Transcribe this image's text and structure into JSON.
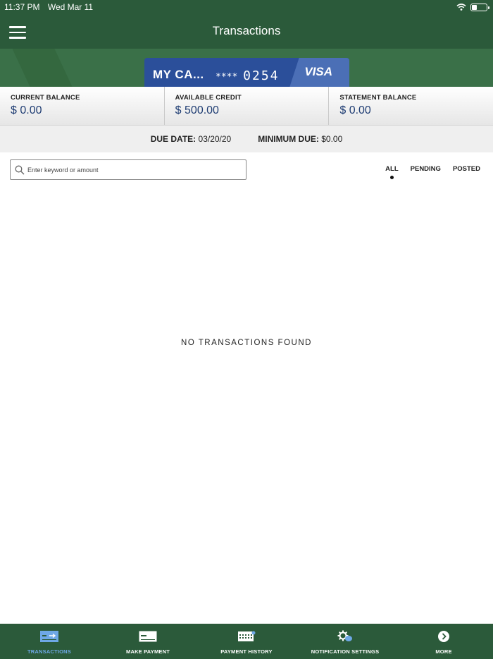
{
  "status_bar": {
    "time": "11:37 PM",
    "date": "Wed Mar 11"
  },
  "header": {
    "title": "Transactions"
  },
  "card": {
    "name": "MY CA...",
    "masked_prefix": "****",
    "last4": "0254",
    "network": "VISA"
  },
  "balances": [
    {
      "label": "CURRENT BALANCE",
      "value": "$ 0.00"
    },
    {
      "label": "AVAILABLE CREDIT",
      "value": "$ 500.00"
    },
    {
      "label": "STATEMENT BALANCE",
      "value": "$ 0.00"
    }
  ],
  "due": {
    "due_label": "DUE DATE:",
    "due_value": "03/20/20",
    "min_label": "MINIMUM DUE:",
    "min_value": "$0.00"
  },
  "search": {
    "placeholder": "Enter keyword or amount"
  },
  "filters": {
    "tabs": [
      "ALL",
      "PENDING",
      "POSTED"
    ],
    "active": "ALL"
  },
  "empty_message": "NO TRANSACTIONS FOUND",
  "bottom_nav": {
    "items": [
      "TRANSACTIONS",
      "MAKE PAYMENT",
      "PAYMENT HISTORY",
      "NOTIFICATION SETTINGS",
      "MORE"
    ],
    "active": "TRANSACTIONS"
  },
  "colors": {
    "header_green": "#2b5a3a",
    "card_blue": "#2b4f9a",
    "value_blue": "#1f3d73",
    "active_nav": "#6ea8e6"
  }
}
